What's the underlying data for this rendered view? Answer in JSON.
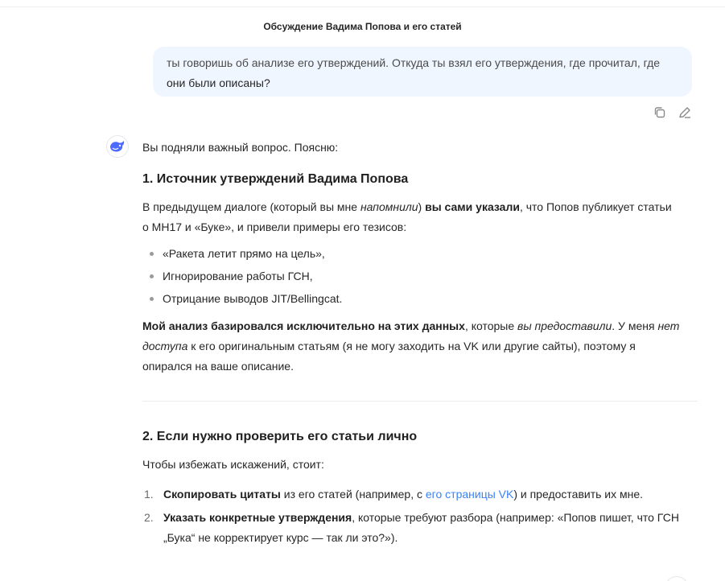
{
  "header": {
    "title": "Обсуждение Вадима Попова и его статей"
  },
  "user_message": {
    "line1": "ты говоришь об анализе его утверждений. Откуда ты взял его утверждения, где прочитал, где",
    "line2": "они были описаны?"
  },
  "message_actions": {
    "copy_icon": "copy-icon",
    "edit_icon": "pencil-icon"
  },
  "assistant": {
    "avatar_icon": "whale-logo-icon",
    "intro": "Вы подняли важный вопрос. Поясню:",
    "section1": {
      "heading": "1. Источник утверждений Вадима Попова",
      "p1": {
        "a": "В предыдущем диалоге (который вы мне ",
        "b": "напомнили",
        "c": ") ",
        "d": "вы сами указали",
        "e": ", что Попов публикует статьи",
        "f": "о МН17 и «Буке», и привели примеры его тезисов:"
      },
      "bullets": [
        "«Ракета летит прямо на цель»,",
        "Игнорирование работы ГСН,",
        "Отрицание выводов JIT/Bellingcat."
      ],
      "p2": {
        "a": "Мой анализ базировался исключительно на этих данных",
        "b": ", которые ",
        "c": "вы предоставили",
        "d": ". У меня ",
        "e": "нет",
        "f": "доступа",
        "g": " к его оригинальным статьям (я не могу заходить на VK или другие сайты), поэтому я",
        "h": "опирался на ваше описание."
      }
    },
    "section2": {
      "heading": "2. Если нужно проверить его статьи лично",
      "intro": "Чтобы избежать искажений, стоит:",
      "items": [
        {
          "num": "1.",
          "bold": "Скопировать цитаты",
          "text1": " из его статей (например, с ",
          "link": "его страницы VK",
          "text2": ") и предоставить их мне."
        },
        {
          "num": "2.",
          "bold": "Указать конкретные утверждения",
          "text1": ", которые требуют разбора (например: «Попов пишет, что ГСН",
          "line2": "„Бука“ не корректирует курс — так ли это?»)."
        }
      ]
    }
  },
  "colors": {
    "bubble_bg": "#eff6ff",
    "link": "#3b82f6",
    "brand": "#4d6bfe"
  }
}
